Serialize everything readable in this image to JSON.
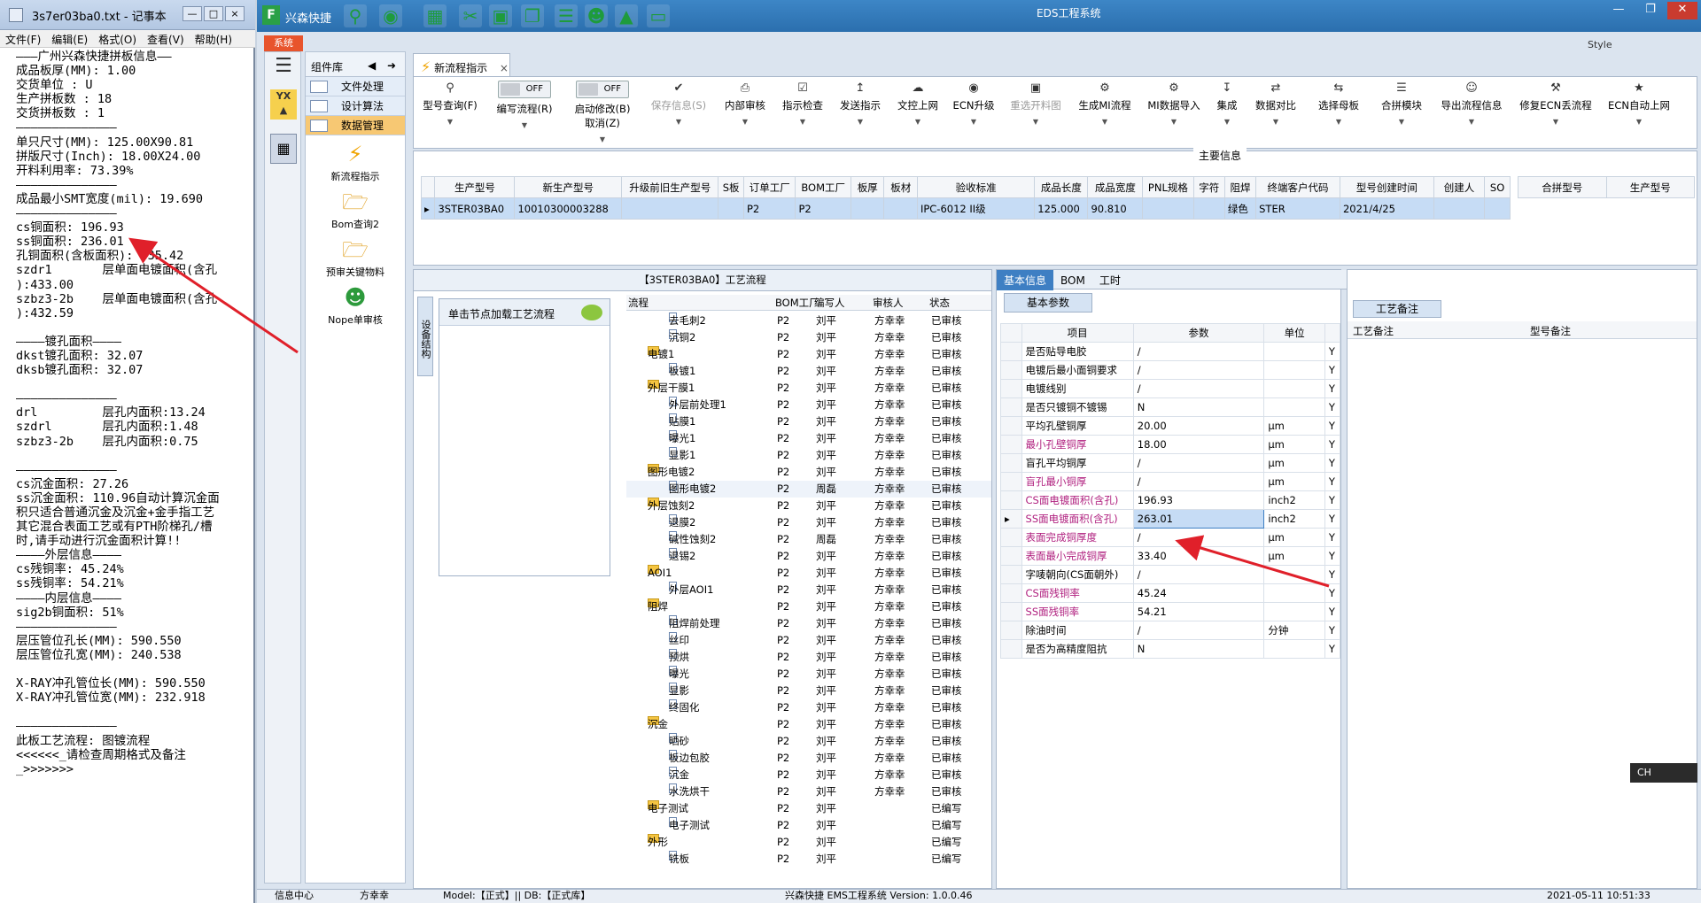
{
  "notepad": {
    "title": "3s7er03ba0.txt - 记事本",
    "menu": [
      "文件(F)",
      "编辑(E)",
      "格式(O)",
      "查看(V)",
      "帮助(H)"
    ],
    "lines": [
      "———广州兴森快捷拼板信息——",
      "成品板厚(MM): 1.00",
      "交货单位 : U",
      "生产拼板数 : 18",
      "交货拼板数 : 1",
      "——————————————",
      "单只尺寸(MM): 125.00X90.81",
      "拼版尺寸(Inch): 18.00X24.00",
      "开料利用率: 73.39%",
      "——————————————",
      "成品最小SMT宽度(mil): 19.690",
      "——————————————",
      "cs铜面积: 196.93",
      "ss铜面积: 236.01",
      "孔铜面积(含板面积): 435.42",
      "szdr1       层单面电镀面积(含孔",
      "):433.00",
      "szbz3-2b    层单面电镀面积(含孔",
      "):432.59",
      "",
      "————镀孔面积————",
      "dkst镀孔面积: 32.07",
      "dksb镀孔面积: 32.07",
      "",
      "——————————————",
      "drl         层孔内面积:13.24",
      "szdrl       层孔内面积:1.48",
      "szbz3-2b    层孔内面积:0.75",
      "",
      "——————————————",
      "cs沉金面积: 27.26",
      "ss沉金面积: 110.96自动计算沉金面",
      "积只适合普通沉金及沉金+金手指工艺",
      "其它混合表面工艺或有PTH阶梯孔/槽",
      "时,请手动进行沉金面积计算!!",
      "————外层信息————",
      "cs残铜率: 45.24%",
      "ss残铜率: 54.21%",
      "————内层信息————",
      "sig2b铜面积: 51%",
      "——————————————",
      "层压管位孔长(MM): 590.550",
      "层压管位孔宽(MM): 240.538",
      "",
      "X-RAY冲孔管位长(MM): 590.550",
      "X-RAY冲孔管位宽(MM): 232.918",
      "",
      "——————————————",
      "此板工艺流程: 图镀流程",
      "<<<<<<_请检查周期格式及备注",
      "_>>>>>>>"
    ]
  },
  "app": {
    "logo": "F",
    "name": "兴森快捷",
    "system_title": "EDS工程系统",
    "system_tab": "系统",
    "style_label": "Style"
  },
  "components": {
    "header": "组件库",
    "items": [
      "文件处理",
      "设计算法",
      "数据管理"
    ],
    "tools": [
      "新流程指示",
      "Bom查询2",
      "预审关键物料",
      "Nope单审核"
    ]
  },
  "doc_tab": {
    "label": "新流程指示"
  },
  "toolbar": {
    "buttons": [
      {
        "label": "型号查询(F)",
        "icon": "search-icon"
      },
      {
        "label": "编写流程(R)",
        "toggle": "OFF"
      },
      {
        "label": "启动修改(B)",
        "toggle": "OFF",
        "sub": "取消(Z)"
      },
      {
        "label": "保存信息(S)",
        "icon": "check-icon",
        "disabled": true
      },
      {
        "label": "内部审核",
        "icon": "printer-icon"
      },
      {
        "label": "指示检查",
        "icon": "checklist-icon"
      },
      {
        "label": "发送指示",
        "icon": "upload-icon"
      },
      {
        "label": "文控上网",
        "icon": "cloud-upload-icon"
      },
      {
        "label": "ECN升级",
        "icon": "binoculars-icon"
      },
      {
        "label": "重选开料图",
        "icon": "image-icon",
        "disabled": true
      },
      {
        "label": "生成MI流程",
        "icon": "gears-icon"
      },
      {
        "label": "MI数据导入",
        "icon": "gears-icon"
      },
      {
        "label": "集成",
        "icon": "download-icon"
      },
      {
        "label": "数据对比",
        "icon": "compare-icon"
      },
      {
        "label": "选择母板",
        "icon": "shuffle-icon"
      },
      {
        "label": "合拼模块",
        "icon": "list-icon"
      },
      {
        "label": "导出流程信息",
        "icon": "smile-icon"
      },
      {
        "label": "修复ECN丢流程",
        "icon": "wrench-icon"
      },
      {
        "label": "ECN自动上网",
        "icon": "star-icon"
      }
    ]
  },
  "main_info": {
    "label": "主要信息",
    "columns": [
      "生产型号",
      "新生产型号",
      "升级前旧生产型号",
      "S板",
      "订单工厂",
      "BOM工厂",
      "板厚",
      "板材",
      "验收标准",
      "成品长度",
      "成品宽度",
      "PNL规格",
      "字符",
      "阻焊",
      "终端客户代码",
      "型号创建时间",
      "创建人",
      "SO"
    ],
    "row": [
      "3STER03BA0",
      "10010300003288",
      "",
      "",
      "P2",
      "P2",
      "",
      "",
      "IPC-6012 II级",
      "125.000",
      "90.810",
      "",
      "",
      "绿色",
      "STER",
      "2021/4/25",
      "",
      ""
    ],
    "merge_columns": [
      "合拼型号",
      "生产型号"
    ]
  },
  "process": {
    "title": "【3STER03BA0】工艺流程",
    "side_tab": "设备结构",
    "load_label": "单击节点加载工艺流程",
    "columns": [
      "流程",
      "BOM工厂",
      "编写人",
      "审核人",
      "状态"
    ],
    "rows": [
      {
        "name": "去毛刺2",
        "level": 2,
        "factory": "P2",
        "writer": "刘平",
        "reviewer": "方幸幸",
        "status": "已审核"
      },
      {
        "name": "沉铜2",
        "level": 2,
        "factory": "P2",
        "writer": "刘平",
        "reviewer": "方幸幸",
        "status": "已审核"
      },
      {
        "name": "电镀1",
        "level": 1,
        "factory": "P2",
        "writer": "刘平",
        "reviewer": "方幸幸",
        "status": "已审核"
      },
      {
        "name": "板镀1",
        "level": 2,
        "factory": "P2",
        "writer": "刘平",
        "reviewer": "方幸幸",
        "status": "已审核"
      },
      {
        "name": "外层干膜1",
        "level": 1,
        "factory": "P2",
        "writer": "刘平",
        "reviewer": "方幸幸",
        "status": "已审核"
      },
      {
        "name": "外层前处理1",
        "level": 2,
        "factory": "P2",
        "writer": "刘平",
        "reviewer": "方幸幸",
        "status": "已审核"
      },
      {
        "name": "贴膜1",
        "level": 2,
        "factory": "P2",
        "writer": "刘平",
        "reviewer": "方幸幸",
        "status": "已审核"
      },
      {
        "name": "曝光1",
        "level": 2,
        "factory": "P2",
        "writer": "刘平",
        "reviewer": "方幸幸",
        "status": "已审核"
      },
      {
        "name": "显影1",
        "level": 2,
        "factory": "P2",
        "writer": "刘平",
        "reviewer": "方幸幸",
        "status": "已审核"
      },
      {
        "name": "图形电镀2",
        "level": 1,
        "factory": "P2",
        "writer": "刘平",
        "reviewer": "方幸幸",
        "status": "已审核"
      },
      {
        "name": "图形电镀2",
        "level": 2,
        "factory": "P2",
        "writer": "周磊",
        "reviewer": "方幸幸",
        "status": "已审核",
        "highlight": true
      },
      {
        "name": "外层蚀刻2",
        "level": 1,
        "factory": "P2",
        "writer": "刘平",
        "reviewer": "方幸幸",
        "status": "已审核"
      },
      {
        "name": "退膜2",
        "level": 2,
        "factory": "P2",
        "writer": "刘平",
        "reviewer": "方幸幸",
        "status": "已审核"
      },
      {
        "name": "碱性蚀刻2",
        "level": 2,
        "factory": "P2",
        "writer": "周磊",
        "reviewer": "方幸幸",
        "status": "已审核"
      },
      {
        "name": "退锡2",
        "level": 2,
        "factory": "P2",
        "writer": "刘平",
        "reviewer": "方幸幸",
        "status": "已审核"
      },
      {
        "name": "AOI1",
        "level": 1,
        "factory": "P2",
        "writer": "刘平",
        "reviewer": "方幸幸",
        "status": "已审核"
      },
      {
        "name": "外层AOI1",
        "level": 2,
        "factory": "P2",
        "writer": "刘平",
        "reviewer": "方幸幸",
        "status": "已审核"
      },
      {
        "name": "阻焊",
        "level": 1,
        "factory": "P2",
        "writer": "刘平",
        "reviewer": "方幸幸",
        "status": "已审核"
      },
      {
        "name": "阻焊前处理",
        "level": 2,
        "factory": "P2",
        "writer": "刘平",
        "reviewer": "方幸幸",
        "status": "已审核"
      },
      {
        "name": "丝印",
        "level": 2,
        "factory": "P2",
        "writer": "刘平",
        "reviewer": "方幸幸",
        "status": "已审核"
      },
      {
        "name": "预烘",
        "level": 2,
        "factory": "P2",
        "writer": "刘平",
        "reviewer": "方幸幸",
        "status": "已审核"
      },
      {
        "name": "曝光",
        "level": 2,
        "factory": "P2",
        "writer": "刘平",
        "reviewer": "方幸幸",
        "status": "已审核"
      },
      {
        "name": "显影",
        "level": 2,
        "factory": "P2",
        "writer": "刘平",
        "reviewer": "方幸幸",
        "status": "已审核"
      },
      {
        "name": "终固化",
        "level": 2,
        "factory": "P2",
        "writer": "刘平",
        "reviewer": "方幸幸",
        "status": "已审核"
      },
      {
        "name": "沉金",
        "level": 1,
        "factory": "P2",
        "writer": "刘平",
        "reviewer": "方幸幸",
        "status": "已审核"
      },
      {
        "name": "晒砂",
        "level": 2,
        "factory": "P2",
        "writer": "刘平",
        "reviewer": "方幸幸",
        "status": "已审核"
      },
      {
        "name": "板边包胶",
        "level": 2,
        "factory": "P2",
        "writer": "刘平",
        "reviewer": "方幸幸",
        "status": "已审核"
      },
      {
        "name": "沉金",
        "level": 2,
        "factory": "P2",
        "writer": "刘平",
        "reviewer": "方幸幸",
        "status": "已审核"
      },
      {
        "name": "水洗烘干",
        "level": 2,
        "factory": "P2",
        "writer": "刘平",
        "reviewer": "方幸幸",
        "status": "已审核"
      },
      {
        "name": "电子测试",
        "level": 1,
        "factory": "P2",
        "writer": "刘平",
        "reviewer": "",
        "status": "已编写"
      },
      {
        "name": "电子测试",
        "level": 2,
        "factory": "P2",
        "writer": "刘平",
        "reviewer": "",
        "status": "已编写"
      },
      {
        "name": "外形",
        "level": 1,
        "factory": "P2",
        "writer": "刘平",
        "reviewer": "",
        "status": "已编写"
      },
      {
        "name": "铣板",
        "level": 2,
        "factory": "P2",
        "writer": "刘平",
        "reviewer": "",
        "status": "已编写"
      }
    ]
  },
  "details": {
    "tabs": [
      "基本信息",
      "BOM",
      "工时"
    ],
    "sub_tab": "基本参数",
    "columns": [
      "项目",
      "参数",
      "单位"
    ],
    "rows": [
      {
        "item": "是否贴导电胶",
        "value": "/",
        "unit": "",
        "flag": "Y"
      },
      {
        "item": "电镀后最小面铜要求",
        "value": "/",
        "unit": "",
        "flag": "Y"
      },
      {
        "item": "电镀线别",
        "value": "/",
        "unit": "",
        "flag": "Y"
      },
      {
        "item": "是否只镀铜不镀锡",
        "value": "N",
        "unit": "",
        "flag": "Y"
      },
      {
        "item": "平均孔壁铜厚",
        "value": "20.00",
        "unit": "μm",
        "flag": "Y"
      },
      {
        "item": "最小孔壁铜厚",
        "value": "18.00",
        "unit": "μm",
        "flag": "Y",
        "pink": true
      },
      {
        "item": "盲孔平均铜厚",
        "value": "/",
        "unit": "μm",
        "flag": "Y"
      },
      {
        "item": "盲孔最小铜厚",
        "value": "/",
        "unit": "μm",
        "flag": "Y",
        "pink": true
      },
      {
        "item": "CS面电镀面积(含孔)",
        "value": "196.93",
        "unit": "inch2",
        "flag": "Y",
        "pink": true
      },
      {
        "item": "SS面电镀面积(含孔)",
        "value": "263.01",
        "unit": "inch2",
        "flag": "Y",
        "pink": true,
        "selected": true
      },
      {
        "item": "表面完成铜厚度",
        "value": "/",
        "unit": "μm",
        "flag": "Y",
        "pink": true
      },
      {
        "item": "表面最小完成铜厚",
        "value": "33.40",
        "unit": "μm",
        "flag": "Y",
        "pink": true
      },
      {
        "item": "字唛朝向(CS面朝外)",
        "value": "/",
        "unit": "",
        "flag": "Y"
      },
      {
        "item": "CS面残铜率",
        "value": "45.24",
        "unit": "",
        "flag": "Y",
        "pink": true
      },
      {
        "item": "SS面残铜率",
        "value": "54.21",
        "unit": "",
        "flag": "Y",
        "pink": true
      },
      {
        "item": "除油时间",
        "value": "/",
        "unit": "分钟",
        "flag": "Y"
      },
      {
        "item": "是否为高精度阻抗",
        "value": "N",
        "unit": "",
        "flag": "Y"
      }
    ]
  },
  "memo": {
    "tab": "工艺备注",
    "columns": [
      "工艺备注",
      "型号备注"
    ]
  },
  "statusbar": {
    "items": [
      "信息中心",
      "方幸幸",
      "Model:【正式】|| DB:【正式库】",
      "兴森快捷 EMS工程系统 Version: 1.0.0.46",
      "2021-05-11 10:51:33"
    ]
  },
  "ime": {
    "label": "CH"
  },
  "colors": {
    "annotation_arrow": "#e0202a",
    "title_bar": "#2b6fae",
    "selection": "#c6dcf5"
  }
}
